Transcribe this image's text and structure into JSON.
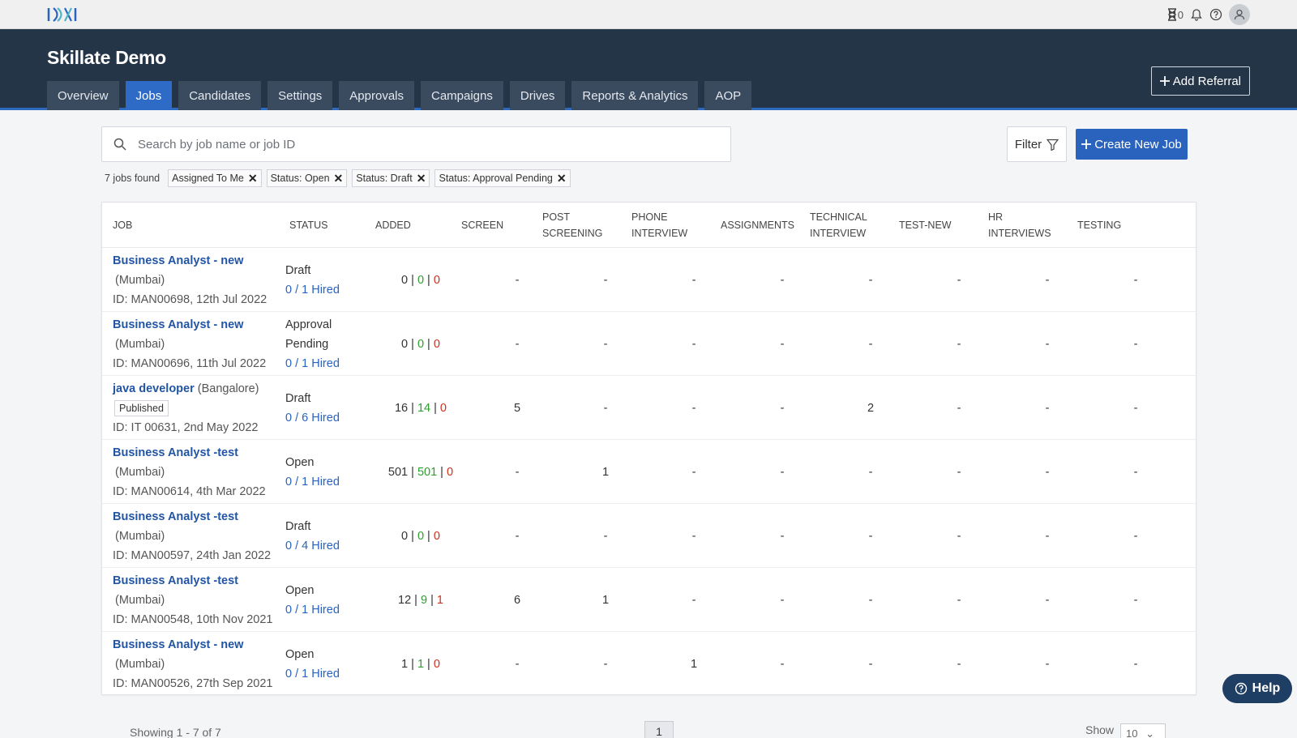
{
  "header": {
    "title": "Skillate Demo",
    "hourglass_count": "0",
    "add_referral": "Add Referral"
  },
  "tabs": [
    {
      "label": "Overview",
      "active": false
    },
    {
      "label": "Jobs",
      "active": true
    },
    {
      "label": "Candidates",
      "active": false
    },
    {
      "label": "Settings",
      "active": false
    },
    {
      "label": "Approvals",
      "active": false
    },
    {
      "label": "Campaigns",
      "active": false
    },
    {
      "label": "Drives",
      "active": false
    },
    {
      "label": "Reports & Analytics",
      "active": false
    },
    {
      "label": "AOP",
      "active": false
    }
  ],
  "toolbar": {
    "search_placeholder": "Search by job name or job ID",
    "filter_label": "Filter",
    "create_label": "Create New Job",
    "jobs_found": "7 jobs found",
    "chips": [
      "Assigned To Me",
      "Status: Open",
      "Status: Draft",
      "Status: Approval Pending"
    ]
  },
  "table": {
    "headers": [
      "JOB",
      "STATUS",
      "ADDED",
      "SCREEN",
      "POST SCREENING",
      "PHONE INTERVIEW",
      "ASSIGNMENTS",
      "TECHNICAL INTERVIEW",
      "TEST-NEW",
      "HR INTERVIEWS",
      "TESTING"
    ],
    "rows": [
      {
        "name": "Business Analyst - new",
        "location": "(Mumbai)",
        "badge": "",
        "id_line": "ID: MAN00698, 12th Jul 2022",
        "status": "Draft",
        "hired": "0 / 1 Hired",
        "added": [
          "0",
          "0",
          "0"
        ],
        "stages": [
          "-",
          "-",
          "-",
          "-",
          "-",
          "-",
          "-",
          "-"
        ]
      },
      {
        "name": "Business Analyst - new",
        "location": "(Mumbai)",
        "badge": "",
        "id_line": "ID: MAN00696, 11th Jul 2022",
        "status": "Approval Pending",
        "hired": "0 / 1 Hired",
        "added": [
          "0",
          "0",
          "0"
        ],
        "stages": [
          "-",
          "-",
          "-",
          "-",
          "-",
          "-",
          "-",
          "-"
        ]
      },
      {
        "name": "java developer",
        "location": "(Bangalore)",
        "badge": "Published",
        "id_line": "ID: IT 00631, 2nd May 2022",
        "status": "Draft",
        "hired": "0 / 6 Hired",
        "added": [
          "16",
          "14",
          "0"
        ],
        "stages": [
          "5",
          "-",
          "-",
          "-",
          "2",
          "-",
          "-",
          "-"
        ]
      },
      {
        "name": "Business Analyst -test",
        "location": "(Mumbai)",
        "badge": "",
        "id_line": "ID: MAN00614, 4th Mar 2022",
        "status": "Open",
        "hired": "0 / 1 Hired",
        "added": [
          "501",
          "501",
          "0"
        ],
        "stages": [
          "-",
          "1",
          "-",
          "-",
          "-",
          "-",
          "-",
          "-"
        ]
      },
      {
        "name": "Business Analyst -test",
        "location": "(Mumbai)",
        "badge": "",
        "id_line": "ID: MAN00597, 24th Jan 2022",
        "status": "Draft",
        "hired": "0 / 4 Hired",
        "added": [
          "0",
          "0",
          "0"
        ],
        "stages": [
          "-",
          "-",
          "-",
          "-",
          "-",
          "-",
          "-",
          "-"
        ]
      },
      {
        "name": "Business Analyst -test",
        "location": "(Mumbai)",
        "badge": "",
        "id_line": "ID: MAN00548, 10th Nov 2021",
        "status": "Open",
        "hired": "0 / 1 Hired",
        "added": [
          "12",
          "9",
          "1"
        ],
        "stages": [
          "6",
          "1",
          "-",
          "-",
          "-",
          "-",
          "-",
          "-"
        ]
      },
      {
        "name": "Business Analyst - new",
        "location": "(Mumbai)",
        "badge": "",
        "id_line": "ID: MAN00526, 27th Sep 2021",
        "status": "Open",
        "hired": "0 / 1 Hired",
        "added": [
          "1",
          "1",
          "0"
        ],
        "stages": [
          "-",
          "-",
          "1",
          "-",
          "-",
          "-",
          "-",
          "-"
        ]
      }
    ]
  },
  "footer": {
    "showing": "Showing 1 - 7 of 7",
    "page": "1",
    "show_label": "Show",
    "page_size": "10"
  },
  "help": {
    "label": "Help"
  },
  "colors": {
    "header_bg": "#253548",
    "accent": "#2e6bc6",
    "link": "#2255a4",
    "green": "#2e9d2e",
    "red": "#d0301f"
  }
}
